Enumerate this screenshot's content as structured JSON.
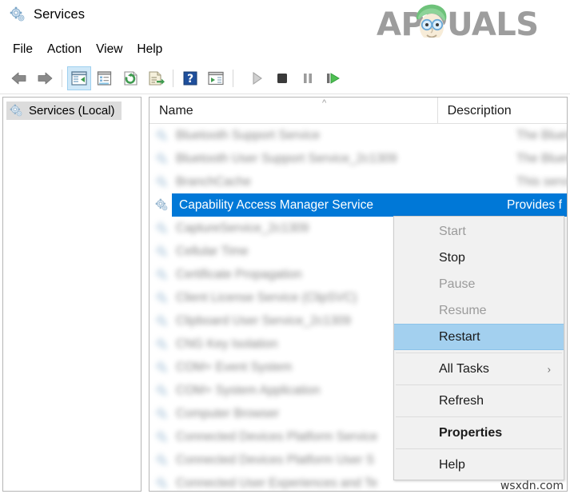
{
  "window": {
    "title": "Services",
    "icon": "services-gear-icon"
  },
  "brand": {
    "logo_text": "APPUALS",
    "logo_icon": "appuals-mascot-icon"
  },
  "menubar": {
    "items": [
      {
        "label": "File"
      },
      {
        "label": "Action"
      },
      {
        "label": "View"
      },
      {
        "label": "Help"
      }
    ]
  },
  "toolbar": {
    "buttons": [
      {
        "name": "back-icon",
        "glyph": "back",
        "state": "enabled"
      },
      {
        "name": "forward-icon",
        "glyph": "forward",
        "state": "enabled"
      },
      {
        "name": "show-hide-console-tree-icon",
        "glyph": "console-tree",
        "state": "active"
      },
      {
        "name": "properties-icon",
        "glyph": "properties",
        "state": "enabled"
      },
      {
        "name": "refresh-icon",
        "glyph": "refresh",
        "state": "enabled"
      },
      {
        "name": "export-list-icon",
        "glyph": "export",
        "state": "enabled"
      },
      {
        "name": "help-icon",
        "glyph": "help",
        "state": "enabled"
      },
      {
        "name": "show-action-pane-icon",
        "glyph": "action-pane",
        "state": "enabled"
      },
      {
        "name": "start-service-icon",
        "glyph": "play",
        "state": "disabled"
      },
      {
        "name": "stop-service-icon",
        "glyph": "stop",
        "state": "enabled"
      },
      {
        "name": "pause-service-icon",
        "glyph": "pause",
        "state": "disabled"
      },
      {
        "name": "restart-service-icon",
        "glyph": "restart",
        "state": "enabled"
      }
    ]
  },
  "sidebar": {
    "node": {
      "label": "Services (Local)",
      "icon": "services-gear-icon",
      "selected": true
    }
  },
  "list": {
    "columns": [
      {
        "key": "name",
        "label": "Name",
        "sort": "ascending",
        "sort_glyph": "^"
      },
      {
        "key": "description",
        "label": "Description"
      }
    ],
    "rows": [
      {
        "name": "Bluetooth Support Service",
        "description": "The Bluet",
        "blurred": true,
        "selected": false
      },
      {
        "name": "Bluetooth User Support Service_2c1309",
        "description": "The Bluet",
        "blurred": true,
        "selected": false
      },
      {
        "name": "BranchCache",
        "description": "This servi",
        "blurred": true,
        "selected": false
      },
      {
        "name": "Capability Access Manager Service",
        "description": "Provides f",
        "blurred": false,
        "selected": true
      },
      {
        "name": "CaptureService_2c1309",
        "description": "",
        "blurred": true,
        "selected": false
      },
      {
        "name": "Cellular Time",
        "description": "",
        "blurred": true,
        "selected": false
      },
      {
        "name": "Certificate Propagation",
        "description": "",
        "blurred": true,
        "selected": false
      },
      {
        "name": "Client License Service (ClipSVC)",
        "description": "",
        "blurred": true,
        "selected": false
      },
      {
        "name": "Clipboard User Service_2c1309",
        "description": "",
        "blurred": true,
        "selected": false
      },
      {
        "name": "CNG Key Isolation",
        "description": "",
        "blurred": true,
        "selected": false
      },
      {
        "name": "COM+ Event System",
        "description": "",
        "blurred": true,
        "selected": false
      },
      {
        "name": "COM+ System Application",
        "description": "",
        "blurred": true,
        "selected": false
      },
      {
        "name": "Computer Browser",
        "description": "",
        "blurred": true,
        "selected": false
      },
      {
        "name": "Connected Devices Platform Service",
        "description": "",
        "blurred": true,
        "selected": false
      },
      {
        "name": "Connected Devices Platform User S",
        "description": "",
        "blurred": true,
        "selected": false
      },
      {
        "name": "Connected User Experiences and Te",
        "description": "",
        "blurred": true,
        "selected": false
      }
    ]
  },
  "context_menu": {
    "items": [
      {
        "label": "Start",
        "state": "disabled",
        "type": "item"
      },
      {
        "label": "Stop",
        "state": "enabled",
        "type": "item"
      },
      {
        "label": "Pause",
        "state": "disabled",
        "type": "item"
      },
      {
        "label": "Resume",
        "state": "disabled",
        "type": "item"
      },
      {
        "label": "Restart",
        "state": "highlighted",
        "type": "item"
      },
      {
        "label": "All Tasks",
        "state": "enabled",
        "type": "submenu",
        "submenu_glyph": "›"
      },
      {
        "label": "Refresh",
        "state": "enabled",
        "type": "item"
      },
      {
        "label": "Properties",
        "state": "enabled",
        "type": "item",
        "emphasis": "bold"
      },
      {
        "label": "Help",
        "state": "enabled",
        "type": "item"
      }
    ]
  },
  "watermark": {
    "text": "wsxdn.com"
  },
  "colors": {
    "selection_blue": "#0078D7",
    "menu_highlight": "#A3D0EF",
    "menu_background": "#F1F1F1",
    "toolbar_active": "#CFE8F8",
    "logo_gray": "#9D9D9D"
  }
}
